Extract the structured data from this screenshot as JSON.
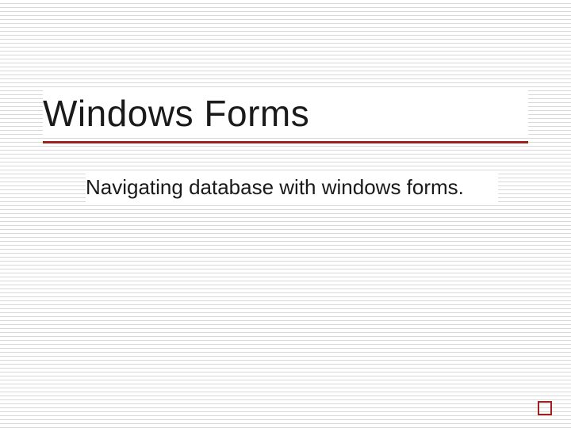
{
  "slide": {
    "title": "Windows Forms",
    "subtitle": "Navigating database with windows forms."
  },
  "colors": {
    "accent": "#a02020",
    "text": "#1a1a1a",
    "line": "#d8d8d8"
  }
}
